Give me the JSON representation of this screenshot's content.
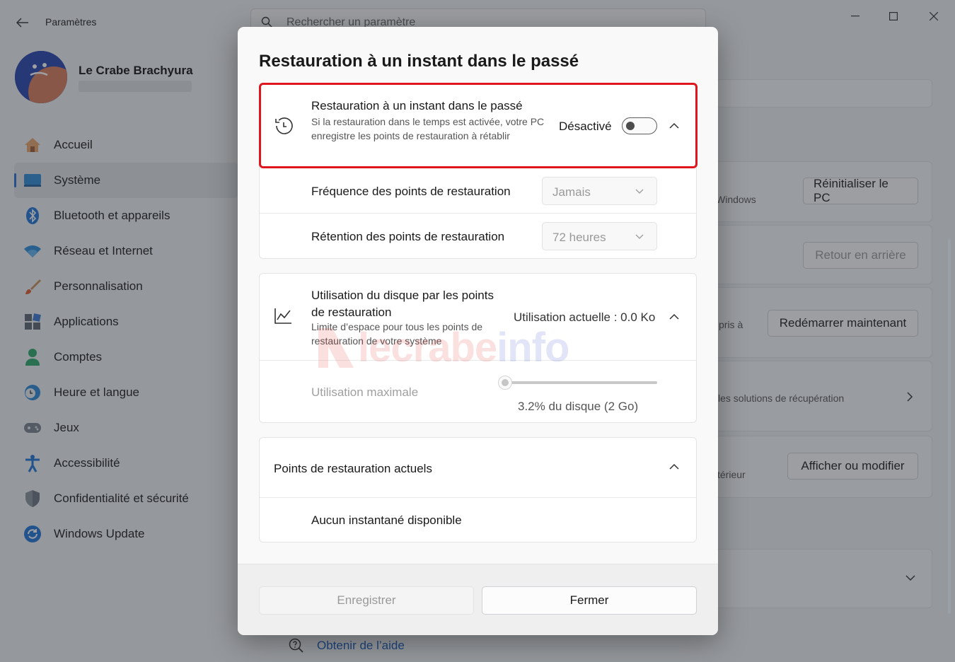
{
  "window": {
    "app_title": "Paramètres",
    "search_placeholder": "Rechercher un paramètre"
  },
  "profile": {
    "name": "Le Crabe Brachyura"
  },
  "sidebar": {
    "items": [
      {
        "label": "Accueil",
        "icon": "home-icon"
      },
      {
        "label": "Système",
        "icon": "system-icon",
        "active": true
      },
      {
        "label": "Bluetooth et appareils",
        "icon": "bluetooth-icon"
      },
      {
        "label": "Réseau et Internet",
        "icon": "wifi-icon"
      },
      {
        "label": "Personnalisation",
        "icon": "brush-icon"
      },
      {
        "label": "Applications",
        "icon": "apps-icon"
      },
      {
        "label": "Comptes",
        "icon": "account-icon"
      },
      {
        "label": "Heure et langue",
        "icon": "clock-globe-icon"
      },
      {
        "label": "Jeux",
        "icon": "gamepad-icon"
      },
      {
        "label": "Accessibilité",
        "icon": "accessibility-icon"
      },
      {
        "label": "Confidentialité et sécurité",
        "icon": "shield-icon"
      },
      {
        "label": "Windows Update",
        "icon": "update-icon"
      }
    ]
  },
  "background": {
    "reset_button": "Réinitialiser le PC",
    "back_button": "Retour en arrière",
    "restart_button": "Redémarrer maintenant",
    "view_button": "Afficher ou modifier",
    "text_windows": "Windows",
    "text_pris": "pris à",
    "text_solutions": "les solutions de récupération",
    "text_exterieur": "térieur",
    "help_link": "Obtenir de l’aide"
  },
  "dialog": {
    "title": "Restauration à un instant dans le passé",
    "restore": {
      "title": "Restauration à un instant dans le passé",
      "description": "Si la restauration dans le temps est activée, votre PC enregistre les points de restauration à rétablir",
      "state": "Désactivé",
      "enabled": false
    },
    "frequency": {
      "label": "Fréquence des points de restauration",
      "value": "Jamais"
    },
    "retention": {
      "label": "Rétention des points de restauration",
      "value": "72 heures"
    },
    "disk": {
      "title": "Utilisation du disque par les points de restauration",
      "description": "Limite d’espace pour tous les points de restauration de votre système",
      "usage": "Utilisation actuelle : 0.0 Ko",
      "max_label": "Utilisation maximale",
      "slider_value_percent": 3.2,
      "slider_caption": "3.2% du disque (2 Go)"
    },
    "points": {
      "title": "Points de restauration actuels",
      "empty": "Aucun instantané disponible"
    },
    "buttons": {
      "save": "Enregistrer",
      "close": "Fermer"
    }
  },
  "watermark": {
    "text_a": "lecrabe",
    "text_b": "info"
  },
  "colors": {
    "accent": "#2b6fd0",
    "highlight": "#e0161e",
    "link": "#1658b8"
  }
}
